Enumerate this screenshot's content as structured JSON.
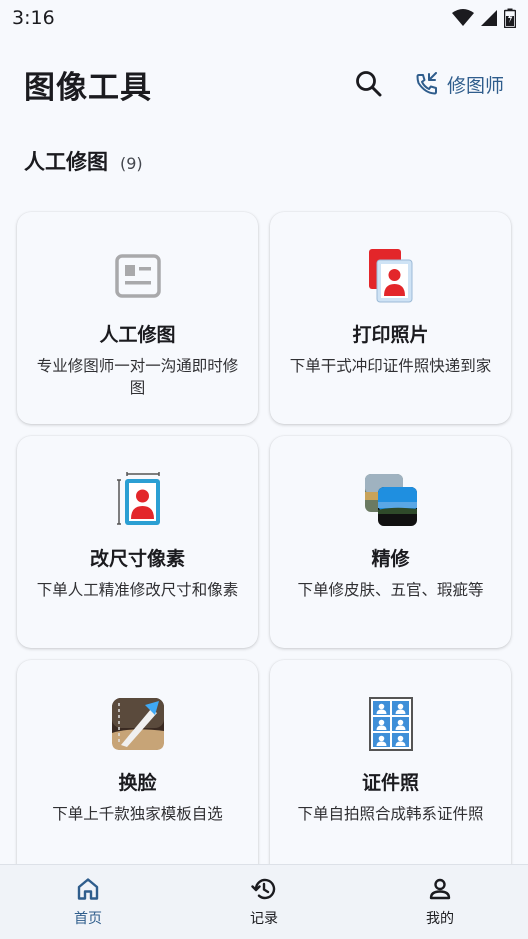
{
  "status_bar": {
    "time": "3:16"
  },
  "header": {
    "title": "图像工具",
    "retoucher_label": "修图师",
    "accent": "#2f5d8c"
  },
  "section": {
    "name": "人工修图",
    "count": "(9)"
  },
  "cards": [
    {
      "title": "人工修图",
      "desc": "专业修图师一对一沟通即时修图",
      "icon": "image-placeholder-icon"
    },
    {
      "title": "打印照片",
      "desc": "下单干式冲印证件照快递到家",
      "icon": "print-photo-icon"
    },
    {
      "title": "改尺寸像素",
      "desc": "下单人工精准修改尺寸和像素",
      "icon": "resize-portrait-icon"
    },
    {
      "title": "精修",
      "desc": "下单修皮肤、五官、瑕疵等",
      "icon": "landscape-photos-icon"
    },
    {
      "title": "换脸",
      "desc": "下单上千款独家模板自选",
      "icon": "face-swap-icon"
    },
    {
      "title": "证件照",
      "desc": "下单自拍照合成韩系证件照",
      "icon": "id-photo-grid-icon"
    }
  ],
  "bottom_nav": {
    "items": [
      {
        "label": "首页",
        "icon": "home-icon",
        "active": true
      },
      {
        "label": "记录",
        "icon": "history-icon",
        "active": false
      },
      {
        "label": "我的",
        "icon": "profile-icon",
        "active": false
      }
    ]
  }
}
